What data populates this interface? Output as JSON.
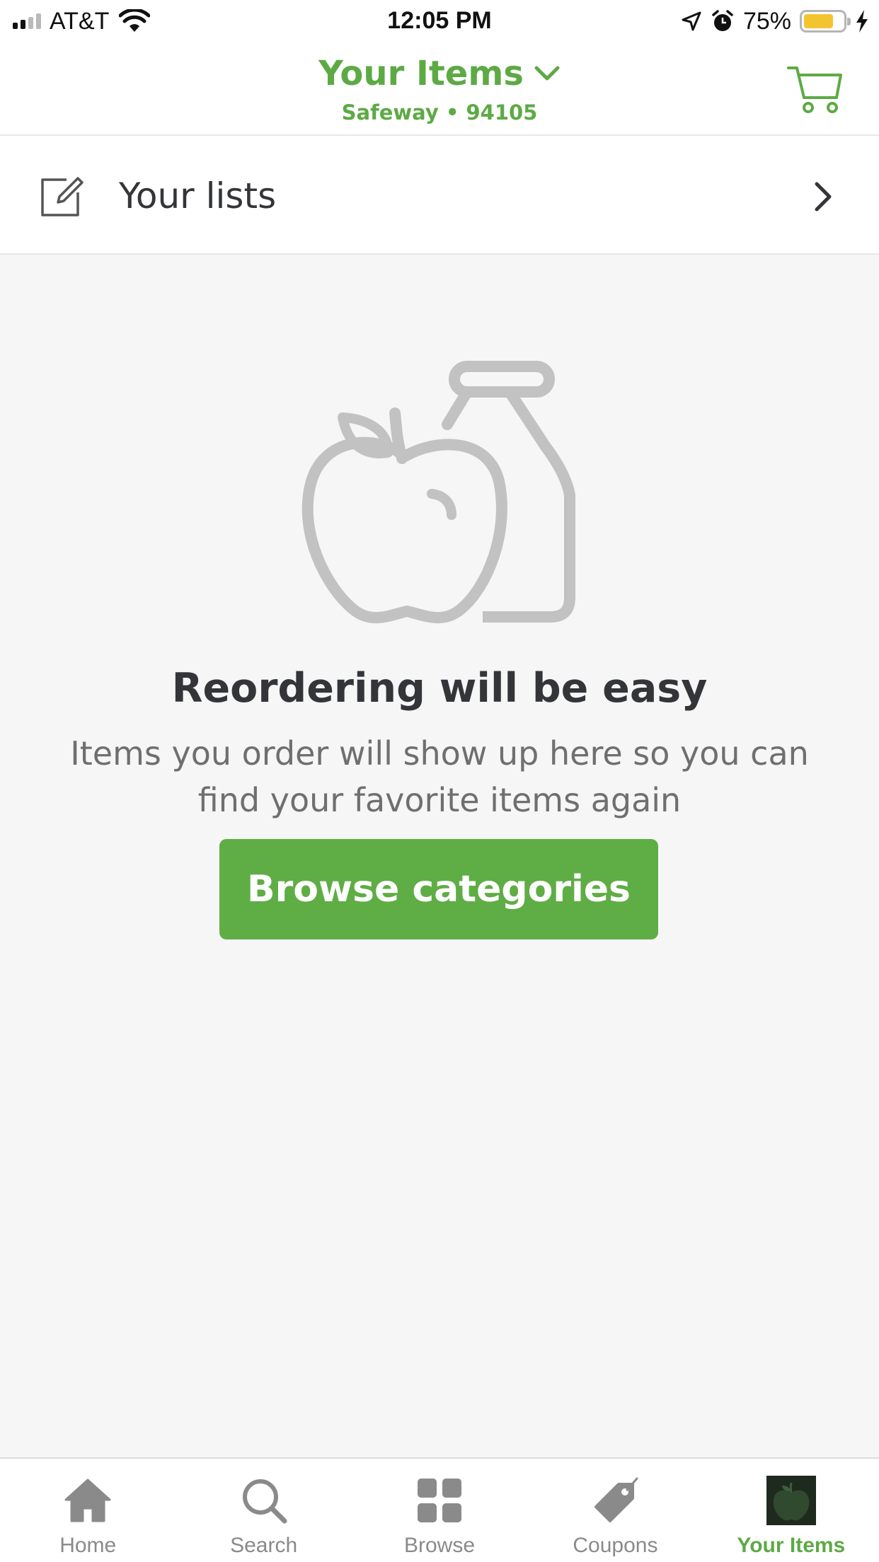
{
  "status_bar": {
    "carrier": "AT&T",
    "time": "12:05 PM",
    "battery_percent": "75%",
    "battery_level": 0.75,
    "icons": [
      "signal-icon",
      "wifi-icon",
      "location-arrow-icon",
      "alarm-icon",
      "battery-icon",
      "charging-bolt-icon"
    ]
  },
  "header": {
    "title": "Your Items",
    "subtitle": "Safeway • 94105",
    "dropdown_icon": "chevron-down-icon",
    "cart_icon": "cart-icon"
  },
  "lists_row": {
    "label": "Your lists",
    "icon": "edit-note-icon",
    "chevron": "chevron-right-icon"
  },
  "empty_state": {
    "illustration": "apple-and-bottle-icon",
    "title": "Reordering will be easy",
    "body": "Items you order will show up here so you can find your favorite items again",
    "button_label": "Browse categories"
  },
  "tab_bar": {
    "tabs": [
      {
        "label": "Home",
        "icon": "home-icon",
        "active": false
      },
      {
        "label": "Search",
        "icon": "search-icon",
        "active": false
      },
      {
        "label": "Browse",
        "icon": "grid-icon",
        "active": false
      },
      {
        "label": "Coupons",
        "icon": "tag-icon",
        "active": false
      },
      {
        "label": "Your Items",
        "icon": "apple-icon",
        "active": true
      }
    ]
  },
  "colors": {
    "brand_green": "#5daa45",
    "button_green": "#5fad45",
    "text_dark": "#343538",
    "text_muted": "#6f6f6f",
    "background": "#f6f6f6",
    "illustration_gray": "#c2c2c2"
  }
}
